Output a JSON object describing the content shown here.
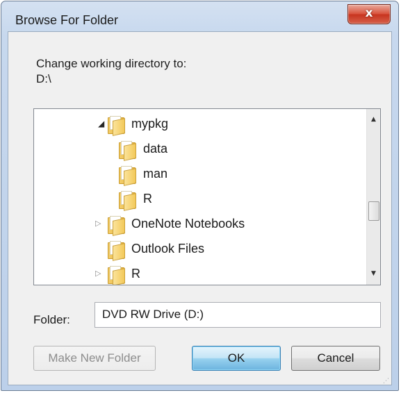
{
  "window": {
    "title": "Browse For Folder",
    "close_glyph": "x"
  },
  "dialog": {
    "prompt_line1": "Change working directory to:",
    "prompt_line2": "D:\\"
  },
  "tree": {
    "items": [
      {
        "label": "mypkg",
        "expander": "open",
        "icon": "folder-icon"
      },
      {
        "label": "data",
        "expander": "none",
        "icon": "folder-icon"
      },
      {
        "label": "man",
        "expander": "none",
        "icon": "folder-icon"
      },
      {
        "label": "R",
        "expander": "none",
        "icon": "folder-icon"
      },
      {
        "label": "OneNote Notebooks",
        "expander": "closed",
        "icon": "folder-icon"
      },
      {
        "label": "Outlook Files",
        "expander": "none",
        "icon": "folder-icon"
      },
      {
        "label": "R",
        "expander": "closed",
        "icon": "folder-icon"
      }
    ],
    "expander_open_glyph": "◢",
    "expander_closed_glyph": "▷",
    "scroll_up_glyph": "▲",
    "scroll_down_glyph": "▼"
  },
  "folder": {
    "label": "Folder:",
    "value": "DVD RW Drive (D:)"
  },
  "buttons": {
    "make_new_folder": "Make New Folder",
    "ok": "OK",
    "cancel": "Cancel"
  },
  "colors": {
    "title_bg": "#c7d8ee",
    "close_button": "#c7341f",
    "default_button": "#98d1ef",
    "client_bg": "#f0f0f0"
  }
}
